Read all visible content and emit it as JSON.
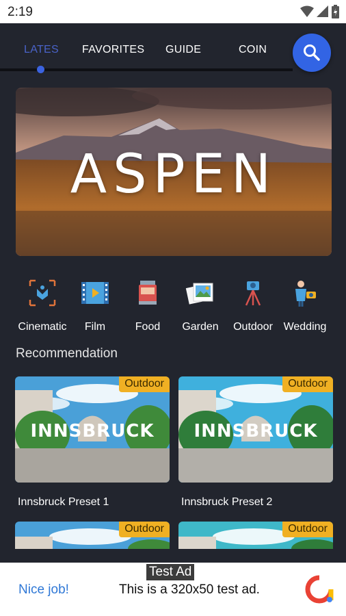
{
  "status_bar": {
    "time": "2:19",
    "icons": [
      "wifi-icon",
      "signal-icon",
      "battery-icon"
    ]
  },
  "tabs": [
    {
      "label": "LATES",
      "active": true
    },
    {
      "label": "FAVORITES",
      "active": false
    },
    {
      "label": "GUIDE",
      "active": false
    },
    {
      "label": "COIN",
      "active": false
    }
  ],
  "search_button": {
    "icon": "search-icon"
  },
  "hero": {
    "title": "ASPEN"
  },
  "categories": [
    {
      "label": "Cinematic",
      "icon": "cinematic-icon"
    },
    {
      "label": "Film",
      "icon": "film-icon"
    },
    {
      "label": "Food",
      "icon": "food-icon"
    },
    {
      "label": "Garden",
      "icon": "garden-icon"
    },
    {
      "label": "Outdoor",
      "icon": "outdoor-icon"
    },
    {
      "label": "Wedding",
      "icon": "wedding-icon"
    }
  ],
  "recommendation": {
    "title": "Recommendation",
    "cards": [
      {
        "badge": "Outdoor",
        "image_text": "INNSBRUCK",
        "title": "Innsbruck Preset 1"
      },
      {
        "badge": "Outdoor",
        "image_text": "INNSBRUCK",
        "title": "Innsbruck Preset 2"
      },
      {
        "badge": "Outdoor",
        "image_text": "",
        "title": ""
      },
      {
        "badge": "Outdoor",
        "image_text": "",
        "title": ""
      }
    ]
  },
  "ad": {
    "tag": "Test Ad",
    "left_text": "Nice job!",
    "text": "This is a 320x50 test ad."
  },
  "colors": {
    "background": "#22252e",
    "accent": "#3264e4",
    "badge": "#f0b023"
  }
}
